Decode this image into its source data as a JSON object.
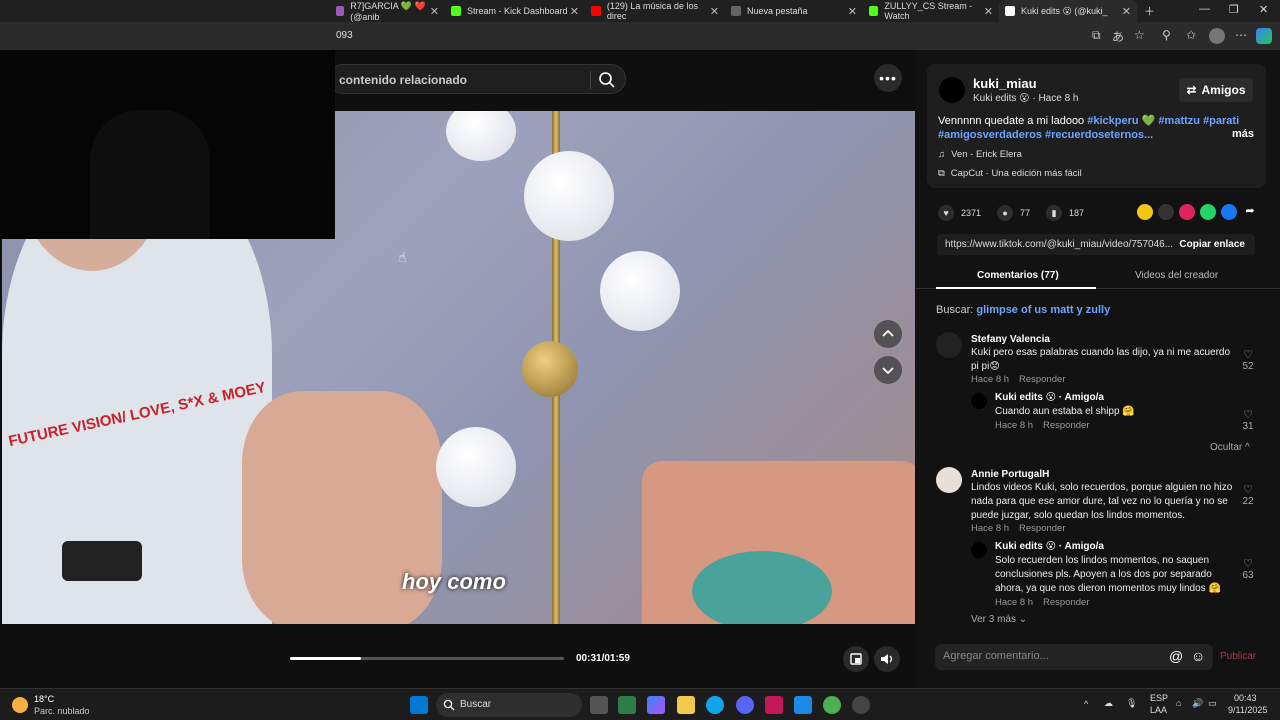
{
  "browser": {
    "tabs": [
      {
        "label": "R7]GARCIA 💚 ❤️ (@anib",
        "color": "#9b59b6"
      },
      {
        "label": "Stream - Kick Dashboard",
        "color": "#53fc18"
      },
      {
        "label": "(129) La música de los direc",
        "color": "#ff0000"
      },
      {
        "label": "Nueva pestaña",
        "color": "#888888"
      },
      {
        "label": "ZULLYY_CS Stream - Watch",
        "color": "#53fc18"
      },
      {
        "label": "Kuki edits 😮 (@kuki_",
        "color": "#ffffff"
      }
    ],
    "url": "093"
  },
  "player": {
    "search_placeholder": "contenido relacionado",
    "caption": "hoy como",
    "shirt_text": "FUTURE VISION/ LOVE, S*X & MOEY",
    "time": "00:31/01:59",
    "progress": 0.26
  },
  "post": {
    "username": "kuki_miau",
    "subline": "Kuki edits 😮 · Hace 8 h",
    "friends_label": "Amigos",
    "desc_text": "Vennnnn quedate a mi ladooo ",
    "tags": [
      "#kickperu 💚",
      " #mattzu",
      " #parati",
      "#amigosverdaderos",
      " #recuerdoseternos..."
    ],
    "more_label": "más",
    "music": "Ven - Erick Elera",
    "capcut": "CapCut · Una edición más fácil",
    "likes": "2371",
    "comments": "77",
    "saves": "187",
    "link": "https://www.tiktok.com/@kuki_miau/video/757046...",
    "copy_label": "Copiar enlace",
    "tab_comments": "Comentarios (77)",
    "tab_videos": "Videos del creador",
    "search_prefix": "Buscar: ",
    "search_term": "glimpse of us matt y zully"
  },
  "comments": [
    {
      "name": "Stefany Valencia",
      "text": "Kuki pero esas palabras cuando las dijo, ya ni me acuerdo pi pi😟",
      "time": "Hace 8 h",
      "reply": "Responder",
      "likes": "52"
    },
    {
      "name": "Kuki edits 😮 · Amigo/a",
      "text": "Cuando aun estaba el shipp 🤗",
      "time": "Hace 8 h",
      "reply": "Responder",
      "likes": "31"
    },
    {
      "name": "Annie PortugalH",
      "text": "Lindos videos Kuki, solo recuerdos, porque alguien no hizo nada para que ese amor dure, tal vez no lo quería y no se puede juzgar, solo quedan los lindos momentos.",
      "time": "Hace 8 h",
      "reply": "Responder",
      "likes": "22"
    },
    {
      "name": "Kuki edits 😮 · Amigo/a",
      "text": "Solo recuerden los lindos momentos, no saquen conclusiones pls. Apoyen a los dos por separado ahora, ya que nos dieron momentos muy lindos 🤗",
      "time": "Hace 8 h",
      "reply": "Responder",
      "likes": "63"
    }
  ],
  "hide_label": "Ocultar ^",
  "see_more": "Ver 3 más ⌄",
  "compose_placeholder": "Agregar comentario...",
  "publish_label": "Publicar",
  "taskbar": {
    "temp": "18°C",
    "weather": "Parc. nublado",
    "search": "Buscar",
    "lang1": "ESP",
    "lang2": "LAA",
    "time": "00:43",
    "date": "9/11/2025"
  }
}
